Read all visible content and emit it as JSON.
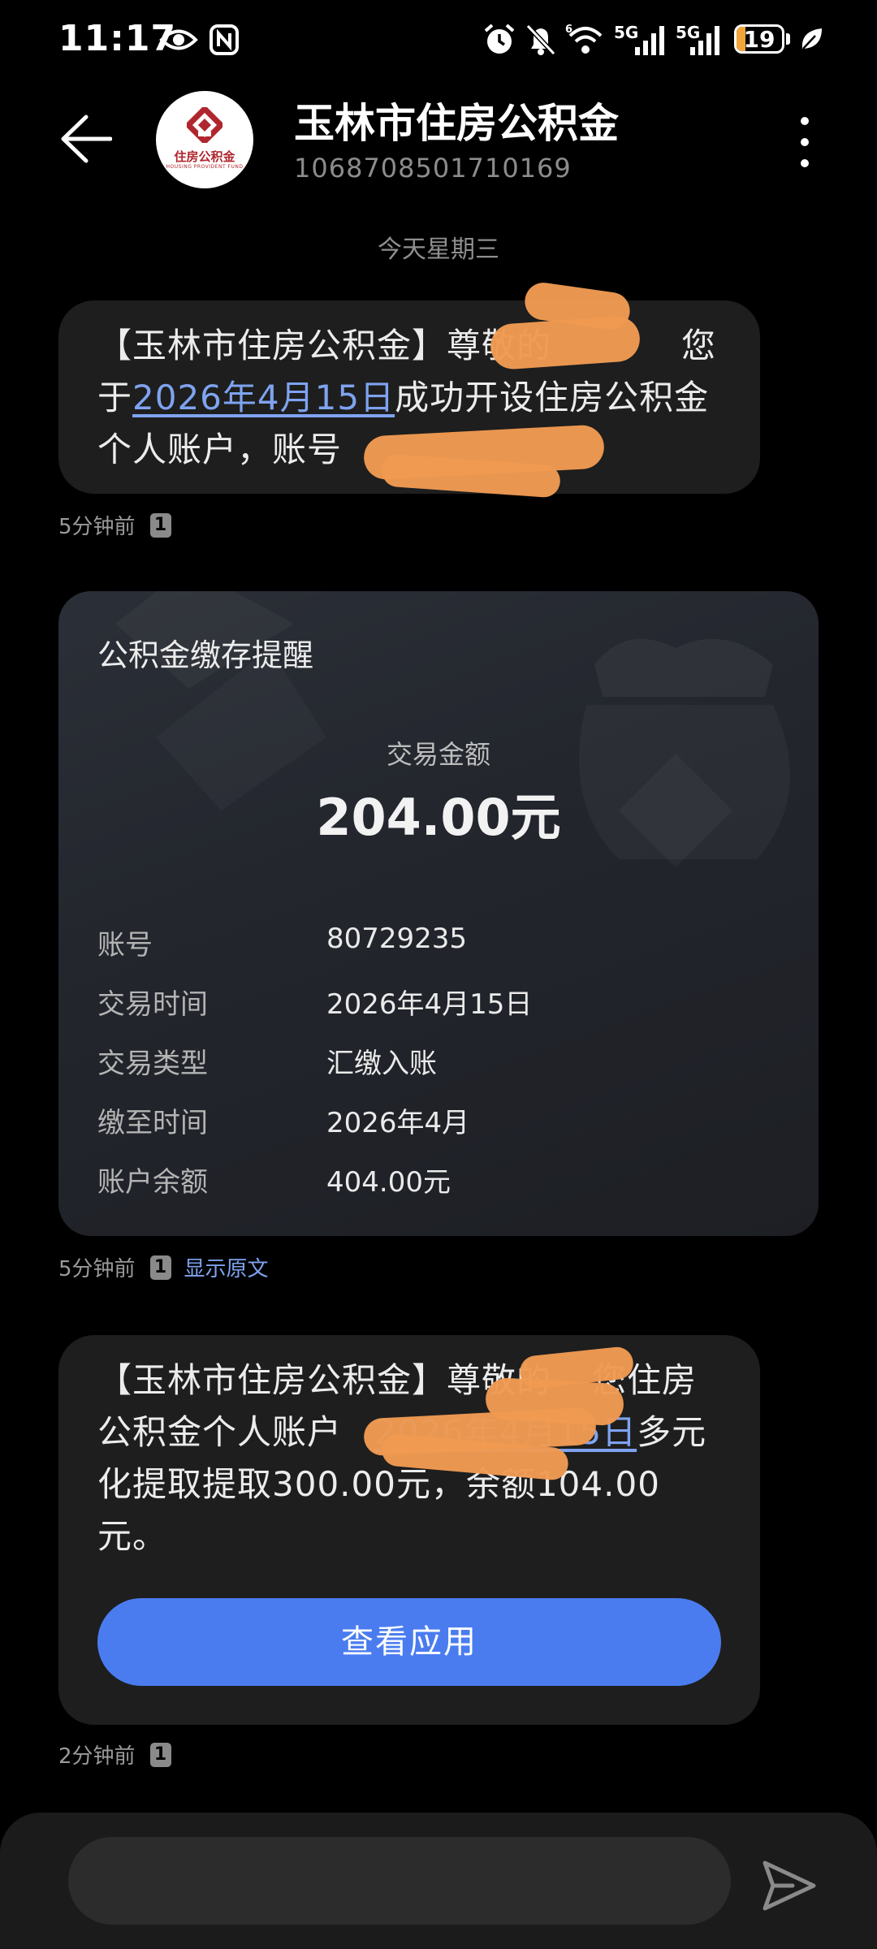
{
  "status_bar": {
    "time": "11:17",
    "battery": "19",
    "battery_percent": 19,
    "network_1": "5G",
    "network_2": "5G",
    "icons": [
      "eye-icon",
      "nfc-icon",
      "alarm-icon",
      "bell-off-icon",
      "wifi-icon",
      "signal-icon",
      "signal-icon",
      "battery-icon",
      "leaf-icon"
    ]
  },
  "header": {
    "title": "玉林市住房公积金",
    "number": "1068708501710169",
    "avatar_title": "住房公积金",
    "avatar_subtitle": "HOUSING PROVIDENT FUND"
  },
  "date_separator": "今天星期三",
  "messages": [
    {
      "segments": [
        "【玉林市住房公积金】尊敬的",
        "您于",
        "2026年4月15日",
        "成功开设住房公积金个人账户，账号"
      ],
      "link": "2026年4月15日",
      "time": "5分钟前",
      "sim": "1"
    },
    {
      "card": {
        "title": "公积金缴存提醒",
        "amount_label": "交易金额",
        "amount": "204.00元",
        "rows": [
          {
            "label": "账号",
            "value": "80729235"
          },
          {
            "label": "交易时间",
            "value": "2026年4月15日"
          },
          {
            "label": "交易类型",
            "value": "汇缴入账"
          },
          {
            "label": "缴至时间",
            "value": "2026年4月"
          },
          {
            "label": "账户余额",
            "value": "404.00元"
          }
        ]
      },
      "time": "5分钟前",
      "sim": "1",
      "show_original": "显示原文"
    },
    {
      "segments": [
        "【玉林市住房公积金】尊敬的",
        "您住房公积金个人账户",
        "2026年4月15日",
        "多元化提取提取300.00元，余额104.00元。"
      ],
      "link": "2026年4月15日",
      "button": "查看应用",
      "time": "2分钟前",
      "sim": "1"
    }
  ],
  "composer": {
    "placeholder": ""
  },
  "colors": {
    "background": "#000000",
    "bubble": "#1e1e1e",
    "link": "#7ea3f0",
    "button": "#4a7cf0",
    "redaction": "#ef9a52",
    "battery": "#f0a43a",
    "brand": "#b0262e"
  }
}
